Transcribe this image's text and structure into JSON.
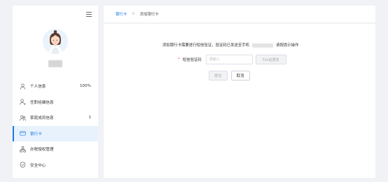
{
  "sidebar": {
    "items": [
      {
        "label": "个人信息",
        "badge": "100%",
        "icon": "user-icon",
        "active": false
      },
      {
        "label": "任职经编信息",
        "badge": "",
        "icon": "user-tag-icon",
        "active": false
      },
      {
        "label": "家庭成员信息",
        "badge": "1",
        "icon": "family-icon",
        "active": false
      },
      {
        "label": "银行卡",
        "badge": "",
        "icon": "bank-card-icon",
        "active": true
      },
      {
        "label": "办税授权管理",
        "badge": "",
        "icon": "org-chart-icon",
        "active": false
      },
      {
        "label": "安全中心",
        "badge": "",
        "icon": "shield-icon",
        "active": false
      }
    ]
  },
  "breadcrumb": {
    "parent": "银行卡",
    "separator": ">",
    "current": "添加银行卡"
  },
  "form": {
    "notice_prefix": "添加银行卡需要进行短信验证，验证码已发送至手机",
    "notice_suffix": "请按提示操作",
    "required_mark": "*",
    "code_label": "短信验证码",
    "code_placeholder": "请输入",
    "resend_label": "51s后重发",
    "submit_label": "提交",
    "cancel_label": "取消"
  },
  "colors": {
    "accent": "#1a7ae8",
    "active_bg": "#e8f2fd",
    "page_bg": "#f0f2f5"
  }
}
